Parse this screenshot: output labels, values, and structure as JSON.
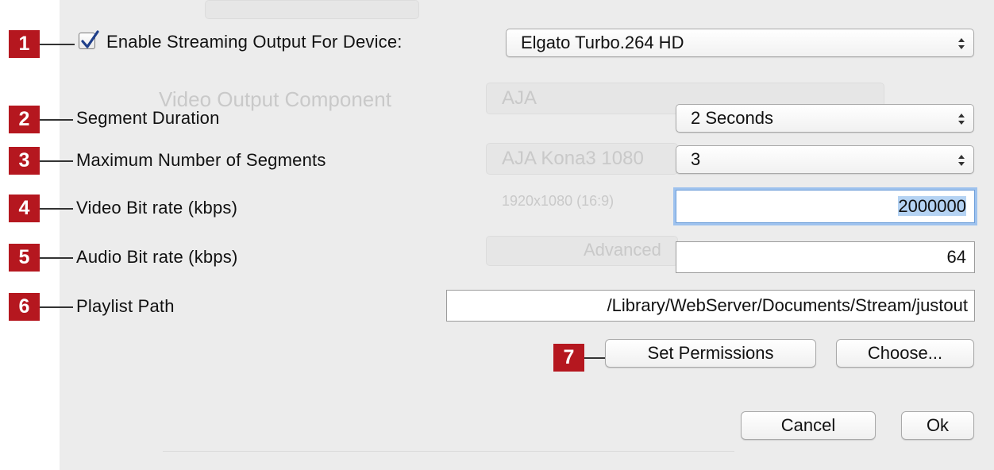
{
  "background_ghost": {
    "video_output_component": "Video Output Component",
    "aja": "AJA",
    "aja_kona": "AJA Kona3 1080",
    "resolution": "1920x1080 (16:9)",
    "advanced": "Advanced"
  },
  "annotations": [
    "1",
    "2",
    "3",
    "4",
    "5",
    "6",
    "7"
  ],
  "streaming": {
    "enable_checked": true,
    "enable_label": "Enable Streaming Output For Device:",
    "device_value": "Elgato Turbo.264 HD"
  },
  "fields": {
    "segment_duration_label": "Segment Duration",
    "segment_duration_value": "2 Seconds",
    "max_segments_label": "Maximum Number of Segments",
    "max_segments_value": "3",
    "video_bitrate_label": "Video Bit rate (kbps)",
    "video_bitrate_value": "2000000",
    "audio_bitrate_label": "Audio Bit rate (kbps)",
    "audio_bitrate_value": "64",
    "playlist_path_label": "Playlist Path",
    "playlist_path_value": "/Library/WebServer/Documents/Stream/justout"
  },
  "buttons": {
    "set_permissions": "Set Permissions",
    "choose": "Choose...",
    "cancel": "Cancel",
    "ok": "Ok"
  },
  "colors": {
    "annotation_red": "#b5171f",
    "focus_ring": "#9ec2ee",
    "panel_bg": "#ececec"
  }
}
